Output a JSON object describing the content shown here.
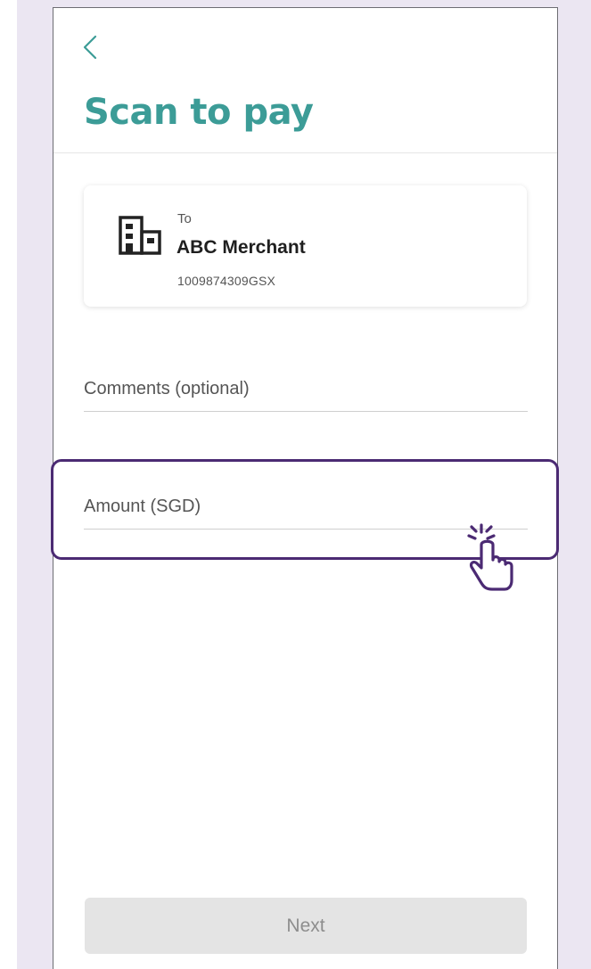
{
  "header": {
    "title": "Scan to pay",
    "back_icon": "chevron-left-icon"
  },
  "merchant": {
    "to_label": "To",
    "name": "ABC Merchant",
    "id": "1009874309GSX",
    "icon": "building-icon"
  },
  "form": {
    "comments_placeholder": "Comments (optional)",
    "comments_value": "",
    "amount_placeholder": "Amount (SGD)",
    "amount_value": ""
  },
  "footer": {
    "next_label": "Next"
  },
  "colors": {
    "accent": "#3c9c97",
    "highlight": "#4b2a73",
    "background": "#ebe6f2",
    "disabled_button": "#e4e4e4"
  }
}
